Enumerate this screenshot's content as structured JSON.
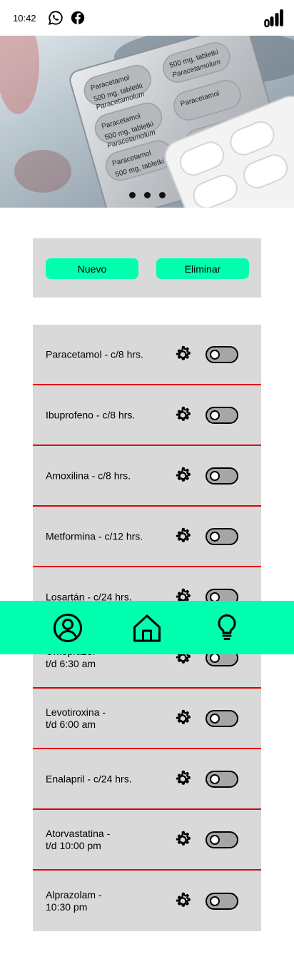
{
  "status_bar": {
    "time": "10:42",
    "icons": [
      "whatsapp-icon",
      "facebook-icon",
      "signal-icon"
    ]
  },
  "hero": {
    "pack_text": [
      "Paracetamol",
      "500 mg, tabletki",
      "Paracetamolum"
    ],
    "carousel_dots": 3
  },
  "actions": {
    "new_label": "Nuevo",
    "delete_label": "Eliminar",
    "accent_color": "#00ffaf"
  },
  "medications": [
    {
      "label": "Paracetamol - c/8 hrs."
    },
    {
      "label": "Ibuprofeno - c/8 hrs."
    },
    {
      "label": "Amoxilina - c/8 hrs."
    },
    {
      "label": "Metformina - c/12 hrs."
    },
    {
      "label": "Losartán - c/24 hrs."
    },
    {
      "label": "Omeprazol -\nt/d 6:30 am"
    },
    {
      "label": "Levotiroxina -\nt/d 6:00 am"
    },
    {
      "label": "Enalapril - c/24 hrs."
    },
    {
      "label": "Atorvastatina -\nt/d 10:00 pm"
    },
    {
      "label": "Alprazolam -\n10:30 pm"
    }
  ],
  "nav": {
    "items": [
      "profile-icon",
      "home-icon",
      "lightbulb-icon"
    ]
  },
  "colors": {
    "panel": "#d9d9d9",
    "divider": "#e00000",
    "toggle_off": "#a6a6a6"
  }
}
